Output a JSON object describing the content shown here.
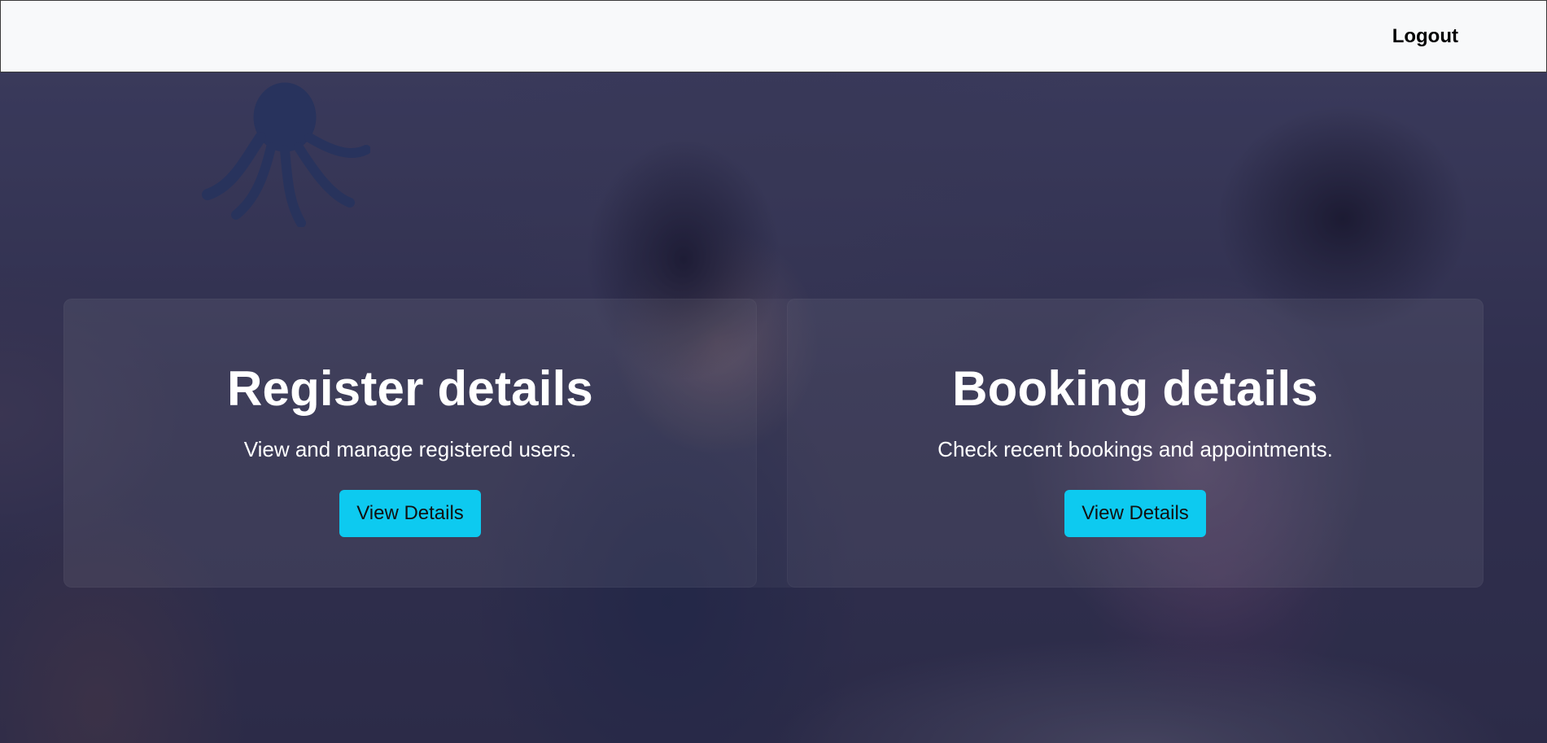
{
  "navbar": {
    "logout_label": "Logout"
  },
  "hero": {
    "background_image": "students-writing-photo",
    "overlay_color": "#1e1c3c"
  },
  "cards": [
    {
      "title": "Register details",
      "description": "View and manage registered users.",
      "button_label": "View Details"
    },
    {
      "title": "Booking details",
      "description": "Check recent bookings and appointments.",
      "button_label": "View Details"
    }
  ],
  "colors": {
    "button_bg": "#0dcaf0",
    "navbar_bg": "#f8f9fa",
    "text_on_dark": "#ffffff"
  },
  "icons": {
    "wall_decoration": "octopus-icon"
  }
}
